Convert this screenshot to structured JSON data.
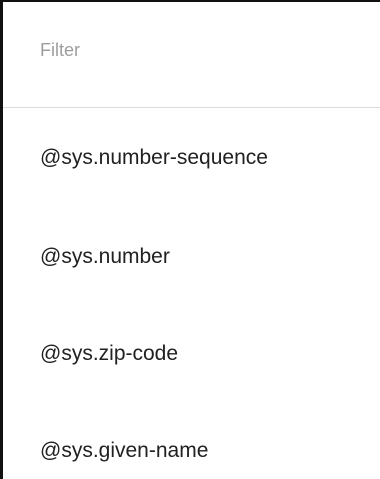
{
  "filter": {
    "placeholder": "Filter",
    "value": ""
  },
  "items": [
    {
      "label": "@sys.number-sequence"
    },
    {
      "label": "@sys.number"
    },
    {
      "label": "@sys.zip-code"
    },
    {
      "label": "@sys.given-name"
    }
  ]
}
